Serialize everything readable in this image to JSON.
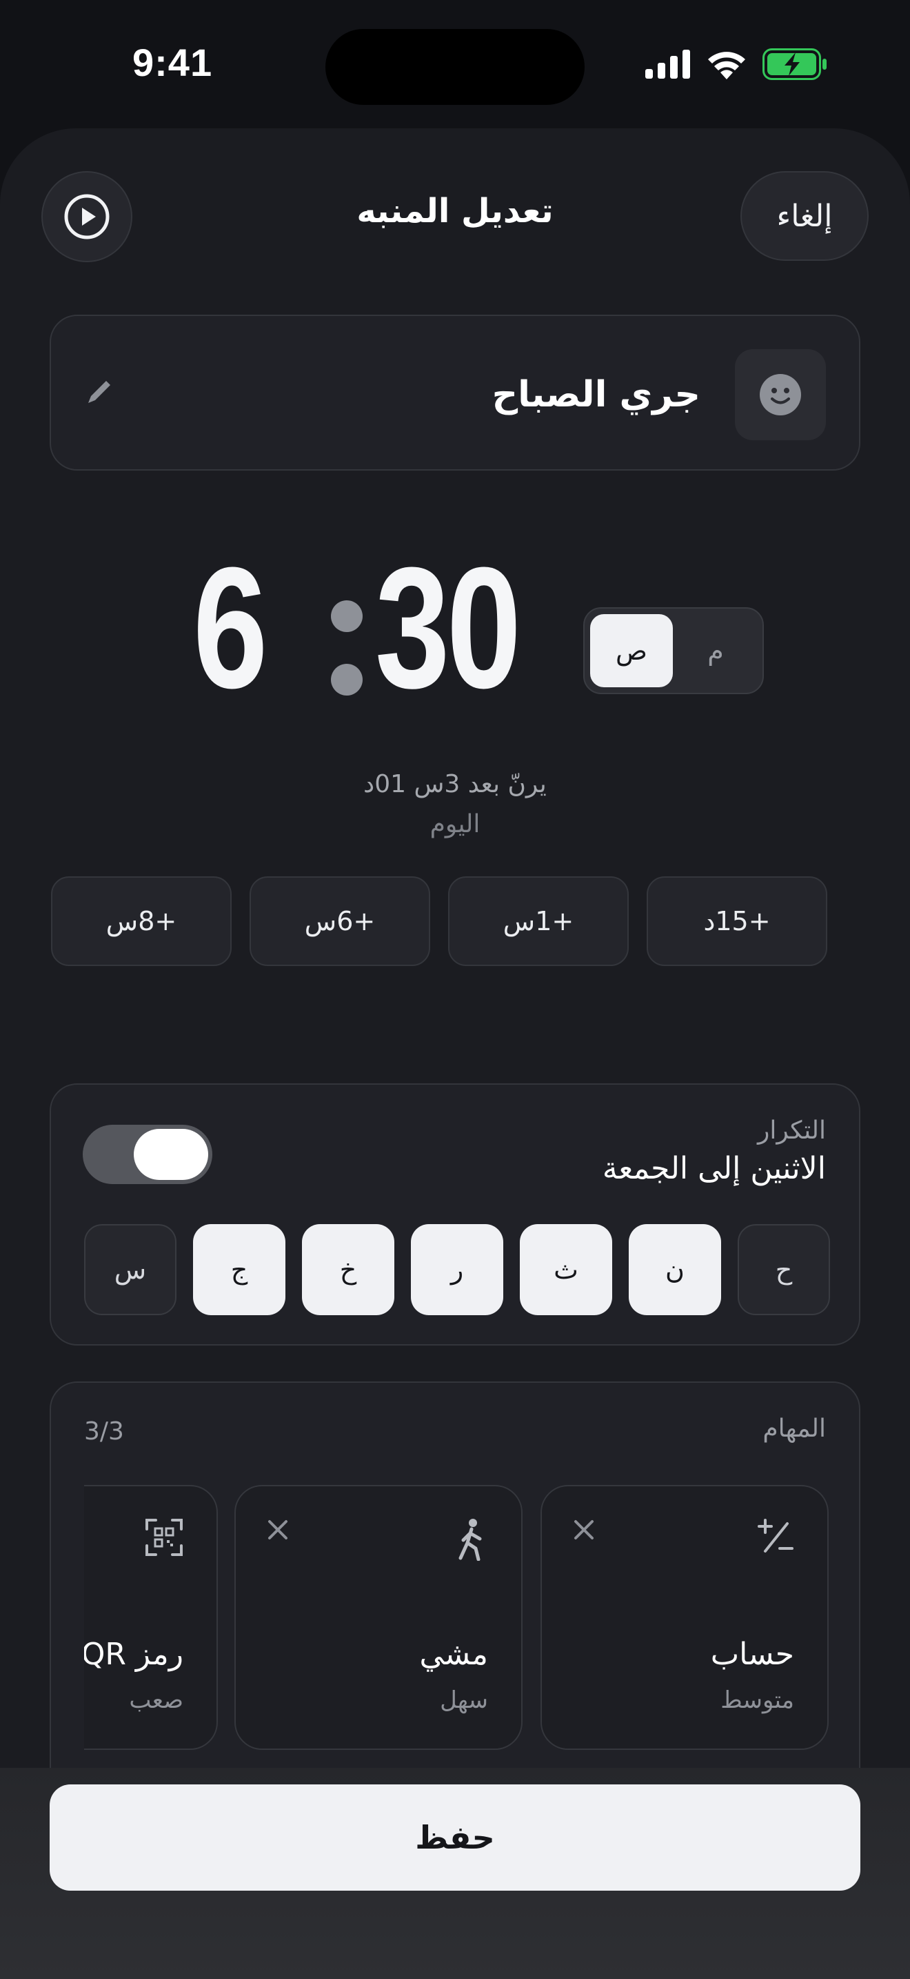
{
  "status_bar": {
    "time": "9:41"
  },
  "header": {
    "title": "تعديل المنبه",
    "cancel_label": "إلغاء"
  },
  "alarm": {
    "name": "جري الصباح",
    "hour": "6",
    "minute": "30",
    "am_label": "ص",
    "pm_label": "م",
    "selected_period": "am"
  },
  "ring_info": {
    "countdown": "يرنّ بعد 3س 01د",
    "day": "اليوم"
  },
  "quick_add": [
    "+15د",
    "+1س",
    "+6س",
    "+8س"
  ],
  "repeat": {
    "label": "التكرار",
    "value": "الاثنين إلى الجمعة",
    "enabled": true,
    "days": [
      {
        "label": "ح",
        "selected": false
      },
      {
        "label": "ن",
        "selected": true
      },
      {
        "label": "ث",
        "selected": true
      },
      {
        "label": "ر",
        "selected": true
      },
      {
        "label": "خ",
        "selected": true
      },
      {
        "label": "ج",
        "selected": true
      },
      {
        "label": "س",
        "selected": false
      }
    ]
  },
  "tasks": {
    "label": "المهام",
    "count": "3/3",
    "items": [
      {
        "name": "حساب",
        "level": "متوسط",
        "icon": "math-icon"
      },
      {
        "name": "مشي",
        "level": "سهل",
        "icon": "walk-icon"
      },
      {
        "name": "رمز QR",
        "level": "صعب",
        "icon": "qr-scan-icon"
      }
    ]
  },
  "save_label": "حفظ",
  "colors": {
    "background": "#111216",
    "surface": "#202127",
    "accent": "#f0f1f4",
    "battery": "#34c759"
  }
}
